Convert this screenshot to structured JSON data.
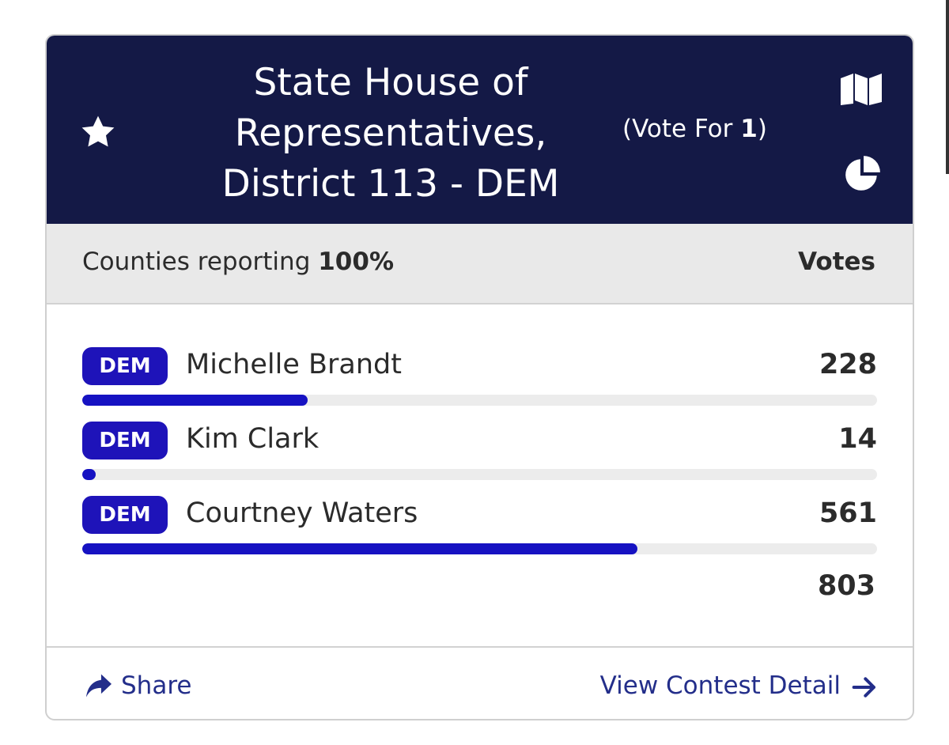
{
  "contest": {
    "title": "State House of Representatives, District 113 - DEM",
    "vote_for_prefix": "(Vote For ",
    "vote_for_count": "1",
    "vote_for_suffix": ")",
    "icons": {
      "favorite": "star-icon",
      "map": "map-icon",
      "chart": "pie-chart-icon"
    }
  },
  "reporting": {
    "label": "Counties reporting ",
    "percent": "100%",
    "votes_header": "Votes"
  },
  "candidates": [
    {
      "party": "DEM",
      "name": "Michelle Brandt",
      "votes": "228",
      "share": 0.284
    },
    {
      "party": "DEM",
      "name": "Kim Clark",
      "votes": "14",
      "share": 0.017
    },
    {
      "party": "DEM",
      "name": "Courtney Waters",
      "votes": "561",
      "share": 0.699
    }
  ],
  "total_votes": "803",
  "footer": {
    "share_label": "Share",
    "detail_label": "View Contest Detail"
  },
  "colors": {
    "header_bg": "#141946",
    "party_dem": "#1e13b9",
    "bar_fill": "#1612c2",
    "link": "#232e8a"
  }
}
